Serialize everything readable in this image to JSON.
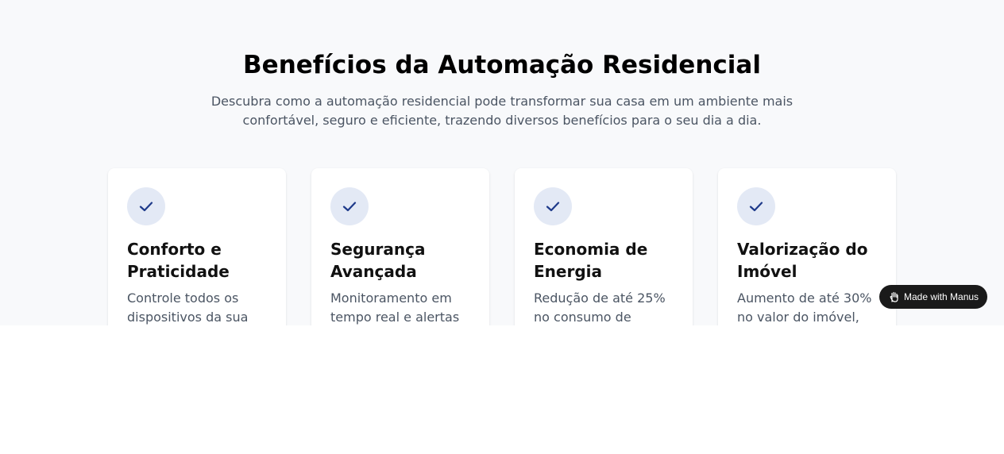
{
  "section": {
    "title": "Benefícios da Automação Residencial",
    "subtitle": "Descubra como a automação residencial pode transformar sua casa em um ambiente mais confortável, seguro e eficiente, trazendo diversos benefícios para o seu dia a dia."
  },
  "cards": [
    {
      "icon": "check-icon",
      "title": "Conforto e Praticidade",
      "text": "Controle todos os dispositivos da sua"
    },
    {
      "icon": "check-icon",
      "title": "Segurança Avançada",
      "text": "Monitoramento em tempo real e alertas"
    },
    {
      "icon": "check-icon",
      "title": "Economia de Energia",
      "text": "Redução de até 25% no consumo de"
    },
    {
      "icon": "check-icon",
      "title": "Valorização do Imóvel",
      "text": "Aumento de até 30% no valor do imóvel,"
    }
  ],
  "badge": {
    "label": "Made with Manus",
    "icon": "manus-hand-icon"
  },
  "colors": {
    "background": "#f8f9fb",
    "accent": "#1e3a8a",
    "icon_circle": "#e3e9f5",
    "badge": "#1a1a1a"
  }
}
